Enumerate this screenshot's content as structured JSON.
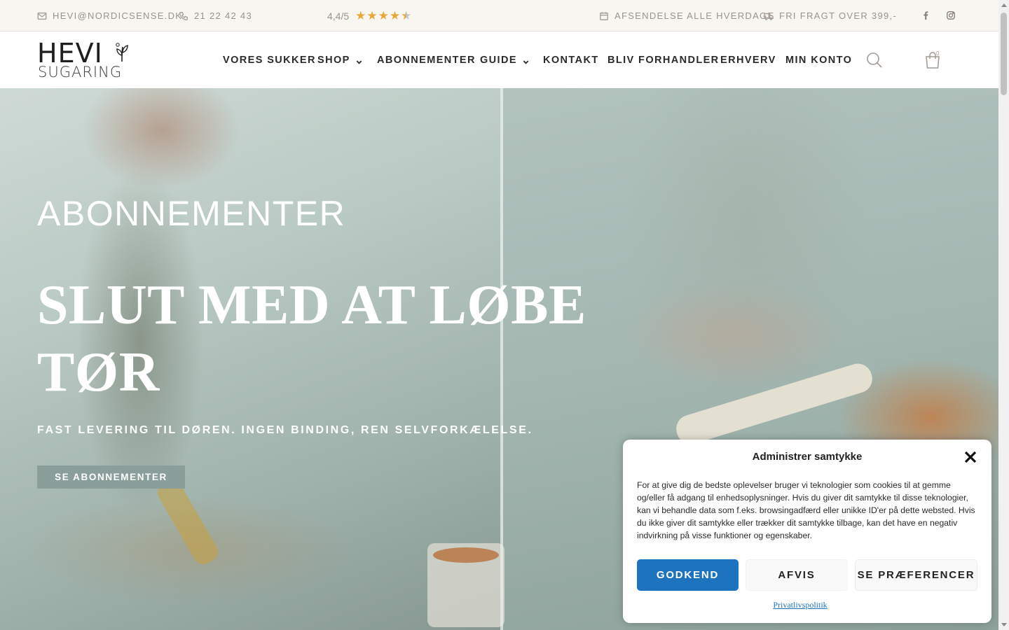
{
  "topbar": {
    "email": "HEVI@NORDICSENSE.DK",
    "phone": "21 22 42 43",
    "rating_text": "4,4/5",
    "rating_value": 4.4,
    "rating_max": 5,
    "shipping_days": "AFSENDELSE ALLE HVERDAGE",
    "free_shipping": "FRI FRAGT OVER 399,-",
    "email_icon": "envelope-icon",
    "phone_icon": "phone-icon",
    "calendar_icon": "calendar-icon",
    "truck_icon": "truck-icon",
    "socials": [
      "facebook-icon",
      "instagram-icon"
    ]
  },
  "header": {
    "logo_line1": "HEVI",
    "logo_line2": "SUGARING",
    "logo_mark": "®",
    "nav": [
      {
        "label": "VORES SUKKER",
        "dropdown": false
      },
      {
        "label": "SHOP",
        "dropdown": true
      },
      {
        "label": "ABONNEMENTER",
        "dropdown": false
      },
      {
        "label": "GUIDE",
        "dropdown": true
      },
      {
        "label": "KONTAKT",
        "dropdown": false
      },
      {
        "label": "BLIV FORHANDLER",
        "dropdown": false
      },
      {
        "label": "ERHVERV",
        "dropdown": false
      },
      {
        "label": "MIN KONTO",
        "dropdown": false
      }
    ],
    "cart_count": "0"
  },
  "hero": {
    "eyebrow": "ABONNEMENTER",
    "title": "SLUT MED AT LØBE TØR",
    "subtitle": "FAST LEVERING TIL DØREN. INGEN BINDING, REN SELVFORKÆLELSE.",
    "cta": "SE ABONNEMENTER"
  },
  "consent": {
    "title": "Administrer samtykke",
    "body": "For at give dig de bedste oplevelser bruger vi teknologier som cookies til at gemme og/eller få adgang til enhedsoplysninger. Hvis du giver dit samtykke til disse teknologier, kan vi behandle data som f.eks. browsingadfærd eller unikke ID'er på dette websted. Hvis du ikke giver dit samtykke eller trækker dit samtykke tilbage, kan det have en negativ indvirkning på visse funktioner og egenskaber.",
    "accept": "GODKEND",
    "deny": "AFVIS",
    "preferences": "SE PRÆFERENCER",
    "privacy_link": "Privatlivspolitik"
  },
  "colors": {
    "accent_blue": "#1e73be",
    "cta_green": "#8a9e9a",
    "star": "#e8a83a",
    "topbar_bg": "#f8f6f1"
  }
}
